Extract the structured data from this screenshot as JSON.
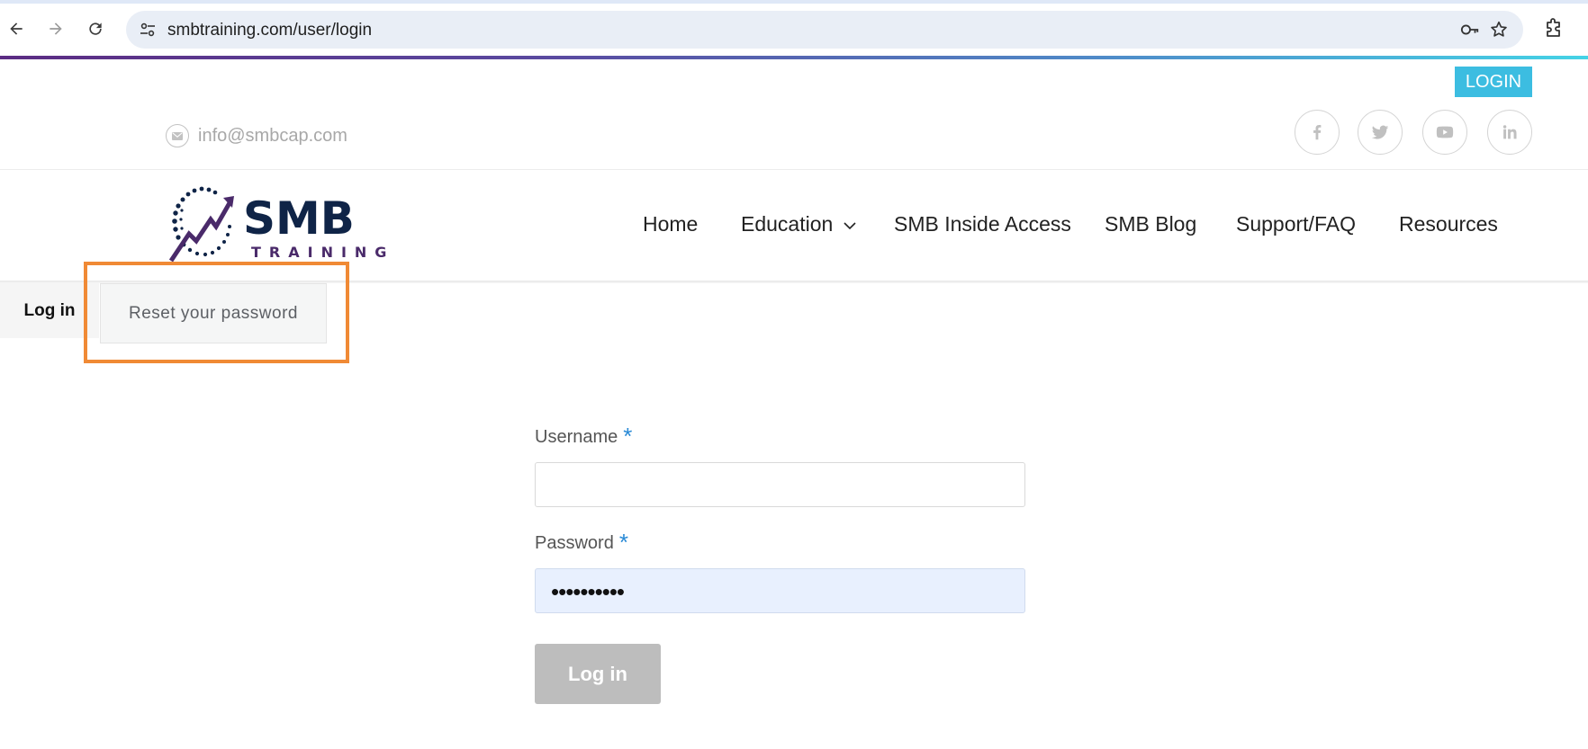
{
  "browser": {
    "url": "smbtraining.com/user/login"
  },
  "topbar": {
    "login_button": "LOGIN",
    "email": "info@smbcap.com",
    "social_icons": [
      "facebook-icon",
      "twitter-icon",
      "youtube-icon",
      "linkedin-icon"
    ]
  },
  "logo": {
    "primary": "SMB",
    "secondary": "TRAINING"
  },
  "nav": {
    "items": [
      {
        "label": "Home"
      },
      {
        "label": "Education"
      },
      {
        "label": "SMB Inside Access"
      },
      {
        "label": "SMB Blog"
      },
      {
        "label": "Support/FAQ"
      },
      {
        "label": "Resources"
      }
    ]
  },
  "tabs": {
    "login": "Log in",
    "reset": "Reset your password"
  },
  "form": {
    "username_label": "Username",
    "password_label": "Password",
    "required_mark": "*",
    "username_value": "",
    "password_value": "••••••••••",
    "submit_label": "Log in"
  },
  "colors": {
    "accent": "#3cbde1",
    "brand_navy": "#0f2447",
    "brand_purple": "#4a2a6a",
    "required": "#2a8ad6",
    "highlight": "#f08a35",
    "autofill": "#e8f0fe"
  }
}
